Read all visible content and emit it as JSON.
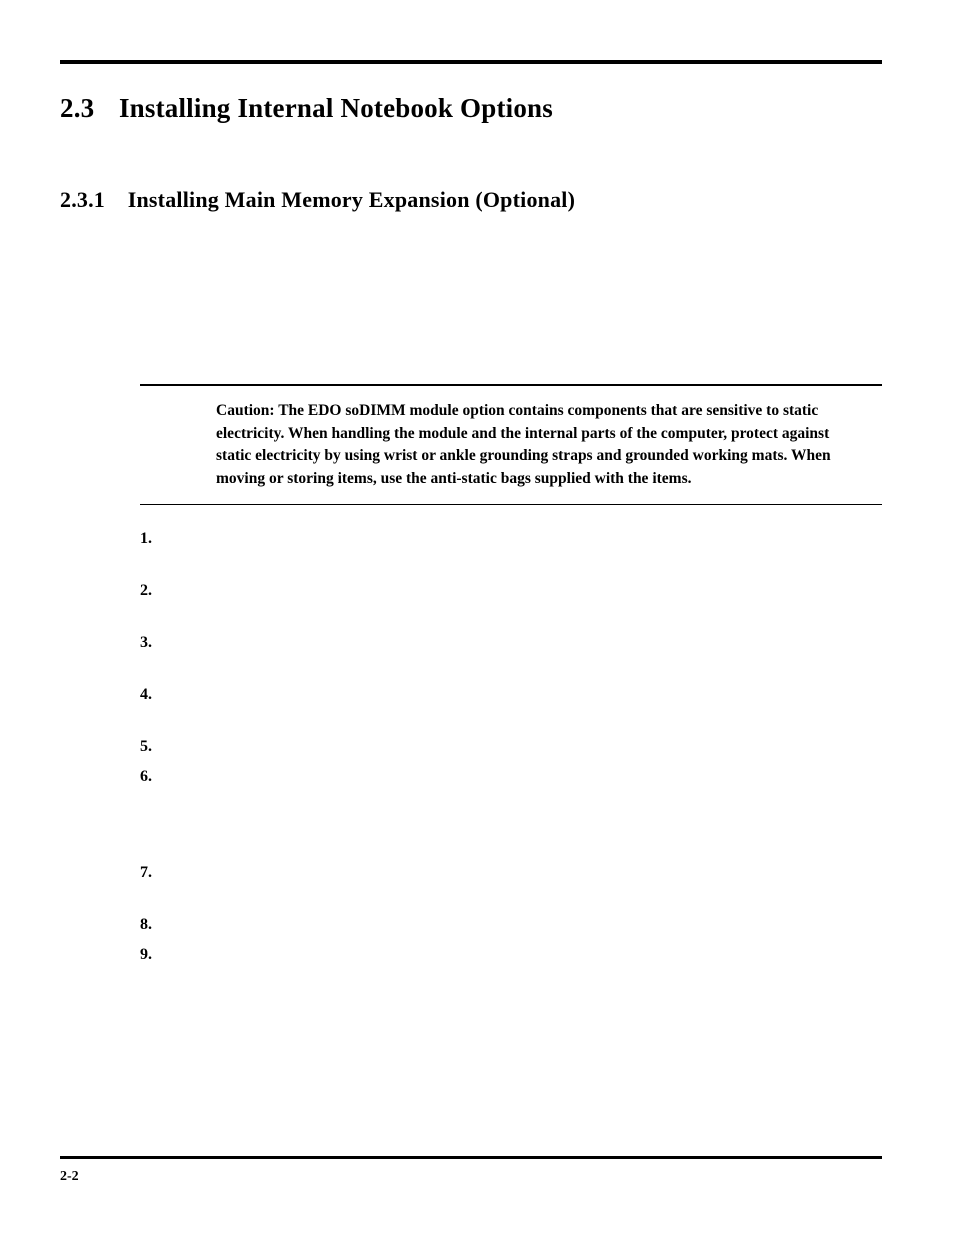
{
  "section": {
    "number": "2.3",
    "title": "Installing Internal Notebook Options"
  },
  "subsection": {
    "number": "2.3.1",
    "title": "Installing Main Memory Expansion (Optional)"
  },
  "caution": {
    "label": "Caution:",
    "text": "The EDO soDIMM module option contains components that are sensitive to static electricity. When handling the module and the internal parts of the computer, protect against static electricity by using wrist or ankle grounding straps and grounded working mats. When moving or storing items, use the anti-static bags supplied with the items."
  },
  "steps": [
    {
      "n": "1."
    },
    {
      "n": "2."
    },
    {
      "n": "3."
    },
    {
      "n": "4."
    },
    {
      "n": "5."
    },
    {
      "n": "6."
    },
    {
      "n": "7."
    },
    {
      "n": "8."
    },
    {
      "n": "9."
    }
  ],
  "footer": {
    "page": "2-2"
  }
}
